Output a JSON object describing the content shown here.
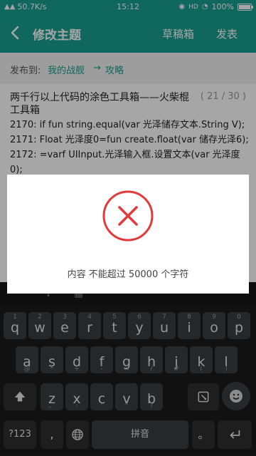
{
  "status_bar": {
    "network_speed": "50.7K/s",
    "time": "15:12",
    "battery_percent": "100%",
    "battery_level": 1.0,
    "hd_label": "HD"
  },
  "header": {
    "title": "修改主题",
    "draft_label": "草稿箱",
    "publish_label": "发表",
    "accent_color": "#1a9e8f"
  },
  "publish_to": {
    "label": "发布到:",
    "forum": "我的战舰",
    "arrow": "→",
    "board": "攻略"
  },
  "post": {
    "subject": "两千行以上代码的涂色工具箱——火柴棍工具箱",
    "counter": "( 21 / 30 )",
    "body_lines": [
      "2170:   if fun string.equal(var 光泽储存文本.String V);",
      "2171:     Float 光泽度0=fun create.float(var 储存光泽6);",
      "2172:     =varf UIInput.光泽输入框.设置文本(var 光泽度",
      "0);"
    ]
  },
  "dialog": {
    "icon": "error-x-icon",
    "icon_color": "#e23a3a",
    "message": "内容 不能超过 50000 个字符"
  },
  "keyboard": {
    "row1": [
      {
        "hint": "1",
        "ch": "q"
      },
      {
        "hint": "2",
        "ch": "w"
      },
      {
        "hint": "3",
        "ch": "e"
      },
      {
        "hint": "4",
        "ch": "r"
      },
      {
        "hint": "5",
        "ch": "t"
      },
      {
        "hint": "6",
        "ch": "y"
      },
      {
        "hint": "7",
        "ch": "u"
      },
      {
        "hint": "8",
        "ch": "i"
      },
      {
        "hint": "9",
        "ch": "o"
      },
      {
        "hint": "0",
        "ch": "p"
      }
    ],
    "row2": [
      {
        "ch": "a",
        "sub": "@"
      },
      {
        "ch": "s",
        "sub": "*"
      },
      {
        "ch": "d",
        "sub": "+"
      },
      {
        "ch": "f",
        "sub": "-"
      },
      {
        "ch": "g",
        "sub": "="
      },
      {
        "ch": "h",
        "sub": "/"
      },
      {
        "ch": "j",
        "sub": "#"
      },
      {
        "ch": "k",
        "sub": "("
      },
      {
        "ch": "l",
        "sub": ")"
      }
    ],
    "row3": [
      {
        "ch": "z",
        "sub": "、"
      },
      {
        "ch": "x",
        "sub": ":"
      },
      {
        "ch": "c",
        "sub": "'"
      },
      {
        "ch": "v",
        "sub": "\""
      },
      {
        "ch": "b",
        "sub": "?"
      }
    ],
    "num_label": "?123",
    "space_label": "拼音",
    "period_label": "。",
    "comma_label": ","
  }
}
